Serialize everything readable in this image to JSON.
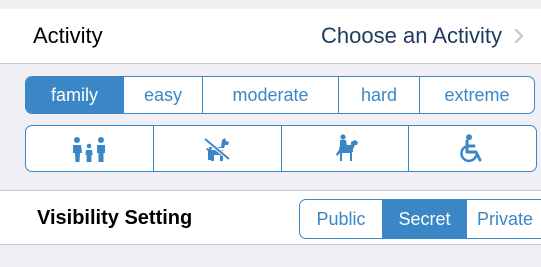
{
  "activity": {
    "label": "Activity",
    "value": "Choose an Activity",
    "chevron_icon": "chevron-right-icon"
  },
  "difficulty": {
    "selected": "family",
    "options": [
      "family",
      "easy",
      "moderate",
      "hard",
      "extreme"
    ]
  },
  "accessibility": {
    "options": [
      {
        "icon": "family-icon"
      },
      {
        "icon": "no-dogs-icon"
      },
      {
        "icon": "horse-rider-icon"
      },
      {
        "icon": "wheelchair-icon"
      }
    ]
  },
  "visibility": {
    "label": "Visibility Setting",
    "selected": "Secret",
    "options": [
      "Public",
      "Secret",
      "Private"
    ]
  },
  "colors": {
    "accent": "#3b86c6",
    "background": "#efeff4",
    "row_background": "#ffffff",
    "activity_value_text": "#1f3a5f"
  }
}
